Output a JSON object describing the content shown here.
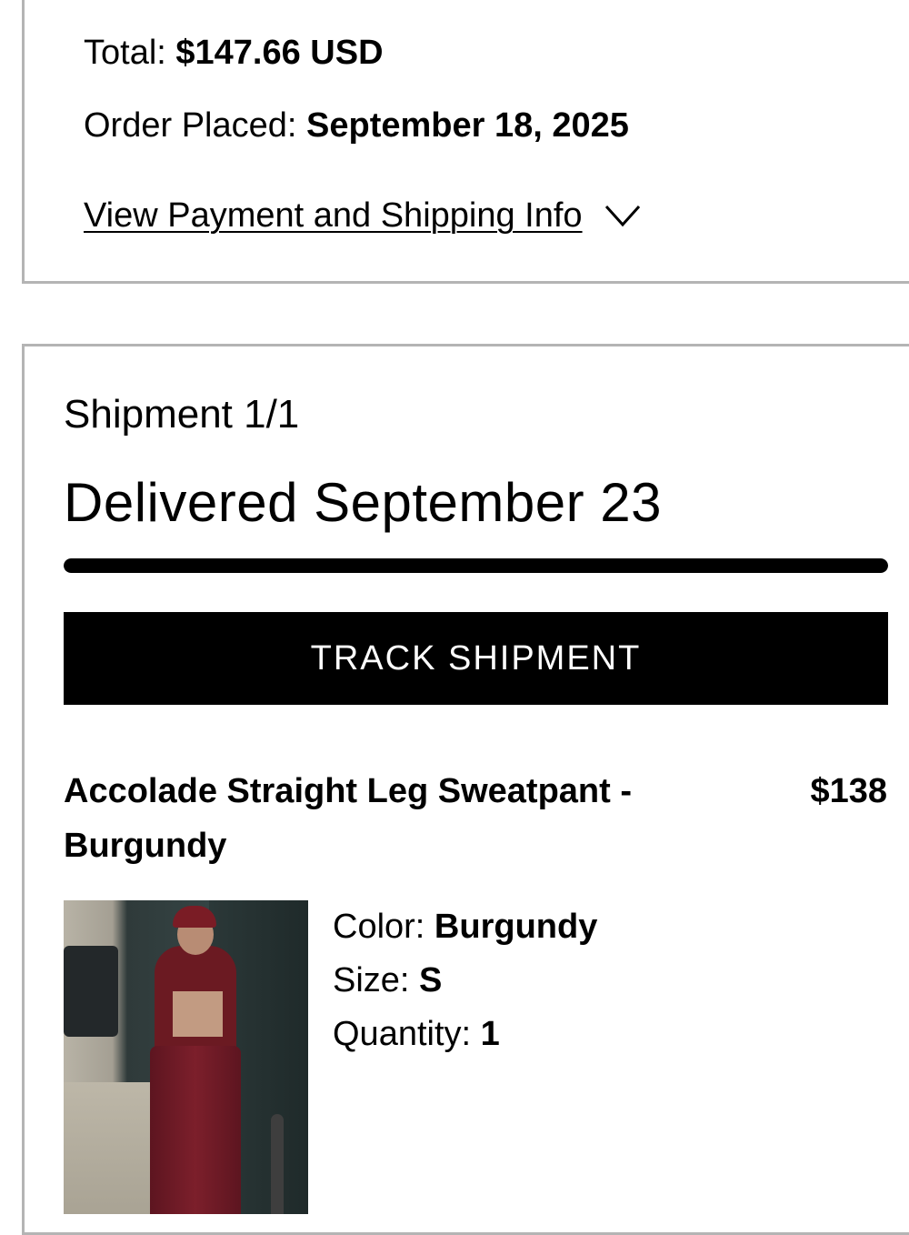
{
  "order": {
    "total_label": "Total: ",
    "total_value": "$147.66 USD",
    "placed_label": "Order Placed: ",
    "placed_value": "September 18, 2025",
    "view_info_label": "View Payment and Shipping Info"
  },
  "shipment": {
    "count_label": "Shipment 1/1",
    "status": "Delivered September 23",
    "progress": 1.0,
    "track_button_label": "TRACK SHIPMENT"
  },
  "item": {
    "name": "Accolade Straight Leg Sweatpant - Burgundy",
    "price": "$138",
    "color_label": "Color: ",
    "color_value": "Burgundy",
    "size_label": "Size: ",
    "size_value": "S",
    "quantity_label": "Quantity: ",
    "quantity_value": "1"
  },
  "icons": {
    "expand": "chevron-down-icon"
  },
  "colors": {
    "text": "#000000",
    "border": "#b4b4b4",
    "button_bg": "#000000",
    "button_text": "#ffffff",
    "progress_fill": "#000000"
  }
}
